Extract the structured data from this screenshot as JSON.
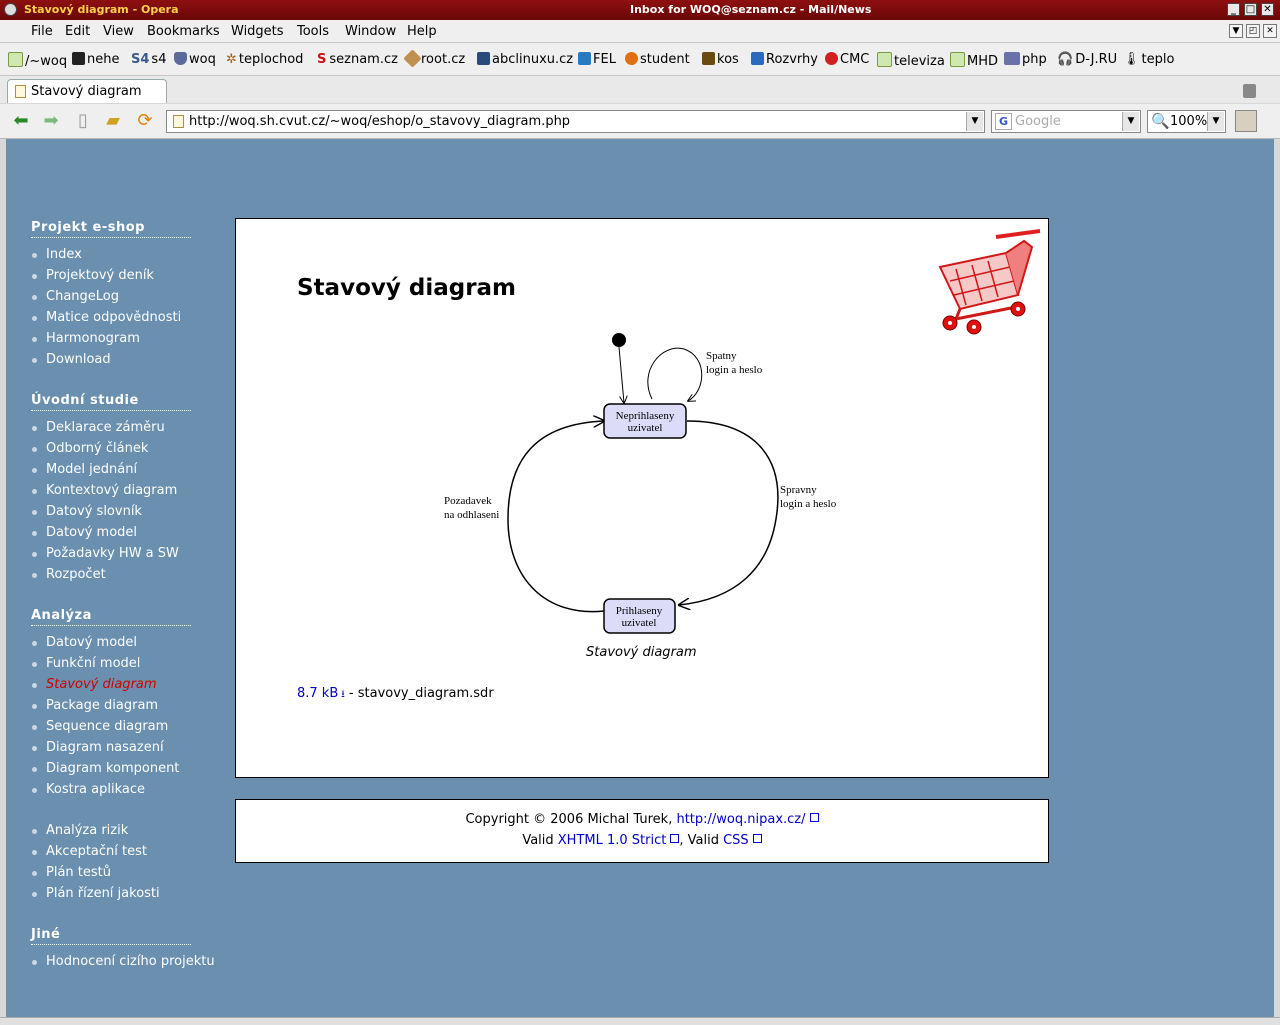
{
  "window": {
    "title": "Stavový diagram - Opera",
    "other_window": "Inbox for WOQ@seznam.cz - Mail/News"
  },
  "menu": [
    "File",
    "Edit",
    "View",
    "Bookmarks",
    "Widgets",
    "Tools",
    "Window",
    "Help"
  ],
  "bookmarks": [
    "/~woq",
    "nehe",
    "s4",
    "woq",
    "teplochod",
    "seznam.cz",
    "root.cz",
    "abclinuxu.cz",
    "FEL",
    "student",
    "kos",
    "Rozvrhy",
    "CMC",
    "televiza",
    "MHD",
    "php",
    "D-J.RU",
    "teplo"
  ],
  "tab": {
    "label": "Stavový diagram"
  },
  "address": {
    "url": "http://woq.sh.cvut.cz/~woq/eshop/o_stavovy_diagram.php"
  },
  "search": {
    "placeholder": "Google"
  },
  "zoom": {
    "value": "100%"
  },
  "sidebar": {
    "sections": [
      {
        "title": "Projekt e-shop",
        "items": [
          "Index",
          "Projektový deník",
          "ChangeLog",
          "Matice odpovědnosti",
          "Harmonogram",
          "Download"
        ]
      },
      {
        "title": "Úvodní studie",
        "items": [
          "Deklarace záměru",
          "Odborný článek",
          "Model jednání",
          "Kontextový diagram",
          "Datový slovník",
          "Datový model",
          "Požadavky HW a SW",
          "Rozpočet"
        ]
      },
      {
        "title": "Analýza",
        "items": [
          "Datový model",
          "Funkční model",
          "Stavový diagram",
          "Package diagram",
          "Sequence diagram",
          "Diagram nasazení",
          "Diagram komponent",
          "Kostra aplikace"
        ],
        "active": "Stavový diagram"
      },
      {
        "title": "",
        "items": [
          "Analýza rizik",
          "Akceptační test",
          "Plán testů",
          "Plán řízení jakosti"
        ]
      },
      {
        "title": "Jiné",
        "items": [
          "Hodnocení cizího projektu"
        ]
      }
    ]
  },
  "main": {
    "title": "Stavový diagram",
    "diagram": {
      "state1_line1": "Neprihlaseny",
      "state1_line2": "uzivatel",
      "state2_line1": "Prihlaseny",
      "state2_line2": "uzivatel",
      "loop_line1": "Spatny",
      "loop_line2": "login a heslo",
      "right_line1": "Spravny",
      "right_line2": "login a heslo",
      "left_line1": "Pozadavek",
      "left_line2": "na odhlaseni"
    },
    "caption": "Stavový diagram",
    "download": {
      "size": "8.7 kB",
      "filename": "- stavovy_diagram.sdr"
    }
  },
  "footer": {
    "copyright": "Copyright © 2006 Michal Turek,",
    "site_link": "http://woq.nipax.cz/",
    "valid1": "Valid",
    "xhtml_link": "XHTML 1.0 Strict",
    "valid2": ", Valid",
    "css_link": "CSS"
  }
}
